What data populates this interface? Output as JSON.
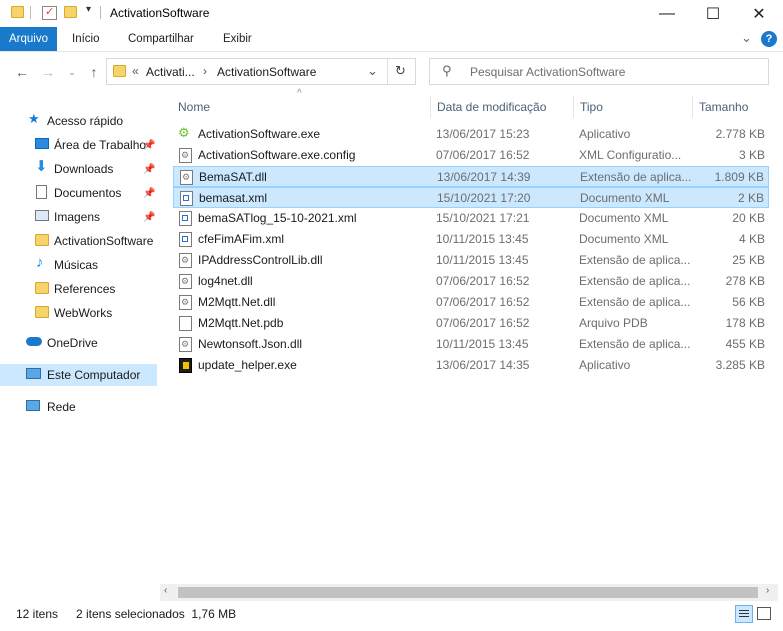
{
  "window": {
    "title": "ActivationSoftware",
    "minimize_glyph": "—",
    "maximize_glyph": "☐",
    "close_glyph": "✕"
  },
  "ribbon": {
    "tabs": [
      "Arquivo",
      "Início",
      "Compartilhar",
      "Exibir"
    ],
    "help_glyph": "?",
    "expand_glyph": "⌄"
  },
  "address": {
    "overflow": "«",
    "crumbs": [
      "Activati...",
      "ActivationSoftware"
    ],
    "separator": "›"
  },
  "search": {
    "placeholder": "Pesquisar ActivationSoftware"
  },
  "nav": {
    "items": [
      {
        "label": "Acesso rápido",
        "icon": "star-icon"
      },
      {
        "label": "Área de Trabalho",
        "icon": "desktop-icon",
        "pinned": true
      },
      {
        "label": "Downloads",
        "icon": "download-icon",
        "pinned": true
      },
      {
        "label": "Documentos",
        "icon": "documents-icon",
        "pinned": true
      },
      {
        "label": "Imagens",
        "icon": "images-icon",
        "pinned": true
      },
      {
        "label": "ActivationSoftware",
        "icon": "folder-icon"
      },
      {
        "label": "Músicas",
        "icon": "music-icon"
      },
      {
        "label": "References",
        "icon": "folder-icon"
      },
      {
        "label": "WebWorks",
        "icon": "folder-icon"
      },
      {
        "label": "OneDrive",
        "icon": "cloud-icon"
      },
      {
        "label": "Este Computador",
        "icon": "computer-icon",
        "selected": true
      },
      {
        "label": "Rede",
        "icon": "network-icon"
      }
    ]
  },
  "columns": {
    "name": "Nome",
    "date": "Data de modificação",
    "type": "Tipo",
    "size": "Tamanho"
  },
  "files": [
    {
      "name": "ActivationSoftware.exe",
      "date": "13/06/2017 15:23",
      "type": "Aplicativo",
      "size": "2.778 KB",
      "icon": "exe-icon"
    },
    {
      "name": "ActivationSoftware.exe.config",
      "date": "07/06/2017 16:52",
      "type": "XML Configuratio...",
      "size": "3 KB",
      "icon": "config-icon"
    },
    {
      "name": "BemaSAT.dll",
      "date": "13/06/2017 14:39",
      "type": "Extensão de aplica...",
      "size": "1.809 KB",
      "icon": "dll-icon",
      "selected": true
    },
    {
      "name": "bemasat.xml",
      "date": "15/10/2021 17:20",
      "type": "Documento XML",
      "size": "2 KB",
      "icon": "xml-icon",
      "selected": true
    },
    {
      "name": "bemaSATlog_15-10-2021.xml",
      "date": "15/10/2021 17:21",
      "type": "Documento XML",
      "size": "20 KB",
      "icon": "xml-icon"
    },
    {
      "name": "cfeFimAFim.xml",
      "date": "10/11/2015 13:45",
      "type": "Documento XML",
      "size": "4 KB",
      "icon": "xml-icon"
    },
    {
      "name": "IPAddressControlLib.dll",
      "date": "10/11/2015 13:45",
      "type": "Extensão de aplica...",
      "size": "25 KB",
      "icon": "dll-icon"
    },
    {
      "name": "log4net.dll",
      "date": "07/06/2017 16:52",
      "type": "Extensão de aplica...",
      "size": "278 KB",
      "icon": "dll-icon"
    },
    {
      "name": "M2Mqtt.Net.dll",
      "date": "07/06/2017 16:52",
      "type": "Extensão de aplica...",
      "size": "56 KB",
      "icon": "dll-icon"
    },
    {
      "name": "M2Mqtt.Net.pdb",
      "date": "07/06/2017 16:52",
      "type": "Arquivo PDB",
      "size": "178 KB",
      "icon": "file-icon"
    },
    {
      "name": "Newtonsoft.Json.dll",
      "date": "10/11/2015 13:45",
      "type": "Extensão de aplica...",
      "size": "455 KB",
      "icon": "dll-icon"
    },
    {
      "name": "update_helper.exe",
      "date": "13/06/2017 14:35",
      "type": "Aplicativo",
      "size": "3.285 KB",
      "icon": "exe-shield-icon"
    }
  ],
  "status": {
    "count": "12 itens",
    "selection": "2 itens selecionados  1,76 MB"
  },
  "colors": {
    "accent": "#1979ca",
    "selection": "#cce8ff",
    "selection_border": "#99d1ff",
    "header_text": "#4c607a"
  }
}
